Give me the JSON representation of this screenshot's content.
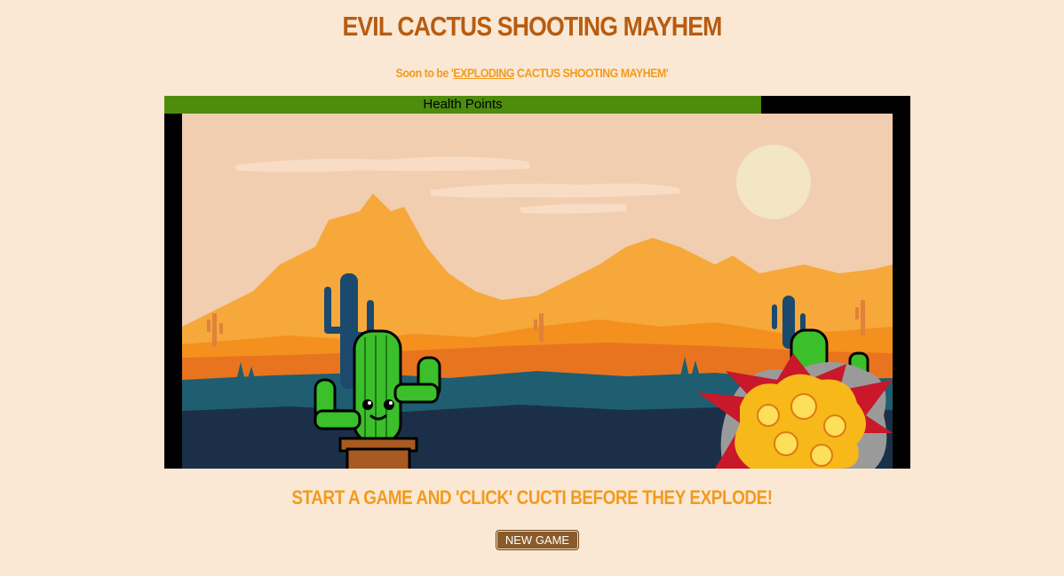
{
  "header": {
    "title": "EVIL CACTUS SHOOTING MAYHEM",
    "subtitle_prefix": "Soon to be '",
    "subtitle_link": "EXPLODING",
    "subtitle_suffix": " CACTUS SHOOTING MAYHEM'"
  },
  "game": {
    "health_label": "Health Points",
    "health_fraction": 0.8,
    "health_color": "#4e8c0e",
    "characters": [
      {
        "name": "cactus-enemy",
        "state": "alive"
      },
      {
        "name": "cactus-enemy",
        "state": "exploding"
      }
    ]
  },
  "instructions": "START A GAME AND 'CLICK' CUCTI BEFORE THEY EXPLODE!",
  "controls": {
    "new_game_label": "NEW GAME"
  },
  "colors": {
    "background": "#fae8d4",
    "title": "#b85c10",
    "accent": "#f39a1e",
    "button": "#8a5a2a"
  }
}
